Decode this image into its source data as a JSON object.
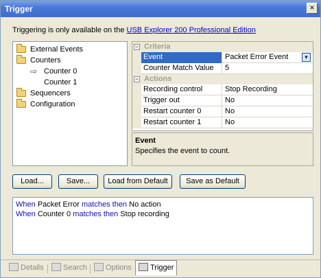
{
  "window": {
    "title": "Trigger",
    "close_glyph": "×"
  },
  "notice": {
    "prefix": "Triggering is only available on the ",
    "link": "USB Explorer 200 Professional Edition"
  },
  "tree": {
    "items": [
      {
        "label": "External Events",
        "icon": "folder-icon"
      },
      {
        "label": "Counters",
        "icon": "folder-icon"
      },
      {
        "label": "Counter 0",
        "icon": "arrow-icon",
        "arrow_glyph": "⇨"
      },
      {
        "label": "Counter 1"
      },
      {
        "label": "Sequencers",
        "icon": "folder-icon"
      },
      {
        "label": "Configuration",
        "icon": "folder-icon"
      }
    ]
  },
  "properties": {
    "categories": [
      {
        "label": "Criteria",
        "glyph": "−"
      },
      {
        "label": "Actions",
        "glyph": "−"
      }
    ],
    "rows": [
      {
        "name": "Event",
        "value": "Packet Error Event"
      },
      {
        "name": "Counter Match Value",
        "value": "5"
      },
      {
        "name": "Recording control",
        "value": "Stop Recording"
      },
      {
        "name": "Trigger out",
        "value": "No"
      },
      {
        "name": "Restart counter 0",
        "value": "No"
      },
      {
        "name": "Restart counter 1",
        "value": "No"
      }
    ],
    "dropdown_glyph": "▼"
  },
  "description": {
    "title": "Event",
    "text": "Specifies the event to count."
  },
  "buttons": {
    "load": "Load...",
    "save": "Save...",
    "load_default": "Load from Default",
    "save_default": "Save as Default"
  },
  "log": {
    "lines": [
      {
        "w": "When",
        "subject": "Packet Error",
        "m": "matches then",
        "action": "No action"
      },
      {
        "w": "When",
        "subject": "Counter 0",
        "m": "matches then",
        "action": "Stop recording"
      }
    ]
  },
  "tabs": [
    {
      "label": "Details",
      "icon": "details-icon"
    },
    {
      "label": "Search",
      "icon": "search-icon"
    },
    {
      "label": "Options",
      "icon": "options-icon"
    },
    {
      "label": "Trigger",
      "icon": "trigger-icon",
      "active": true
    }
  ],
  "colors": {
    "accent": "#316ac5",
    "keyword": "#1010b0",
    "link": "#0000cc"
  }
}
